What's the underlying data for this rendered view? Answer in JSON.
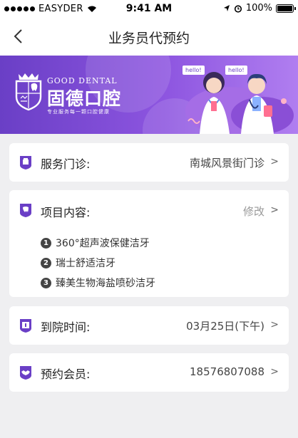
{
  "status_bar": {
    "carrier": "EASYDER",
    "time": "9:41 AM",
    "battery": "100%"
  },
  "nav": {
    "title": "业务员代预约"
  },
  "banner": {
    "brand_en": "GOOD DENTAL",
    "brand_cn": "固德口腔",
    "brand_sub": "专业服务每一颗口腔健康",
    "hello_1": "hello!",
    "hello_2": "hello!"
  },
  "clinic": {
    "label": "服务门诊:",
    "value": "南城风景街门诊",
    "chevron": ">"
  },
  "project": {
    "label": "项目内容:",
    "edit": "修改",
    "chevron": ">",
    "items": [
      {
        "num": "1",
        "name": "360°超声波保健洁牙"
      },
      {
        "num": "2",
        "name": "瑞士舒适洁牙"
      },
      {
        "num": "3",
        "name": "臻美生物海盐喷砂洁牙"
      }
    ]
  },
  "arrival": {
    "label": "到院时间:",
    "value": "03月25日(下午)",
    "chevron": ">"
  },
  "member": {
    "label": "预约会员:",
    "value": "18576807088",
    "chevron": ">"
  },
  "colors": {
    "accent": "#6a3fc6",
    "background": "#efeff1",
    "card": "#ffffff"
  }
}
